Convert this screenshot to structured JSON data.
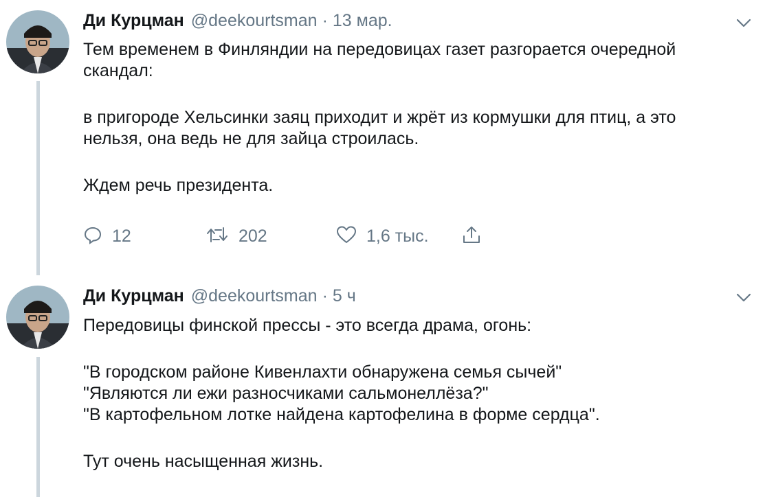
{
  "tweets": [
    {
      "author_name": "Ди Курцман",
      "handle": "@deekourtsman",
      "separator": "·",
      "time": "13 мар.",
      "lines": [
        "Тем временем в Финляндии на передовицах газет разгорается очередной",
        "скандал:",
        "в пригороде Хельсинки заяц приходит и жрёт из кормушки для птиц, а это",
        "нельзя, она ведь не для зайца строилась.",
        "Ждем речь президента."
      ],
      "replies": "12",
      "retweets": "202",
      "likes": "1,6 тыс."
    },
    {
      "author_name": "Ди Курцман",
      "handle": "@deekourtsman",
      "separator": "·",
      "time": "5 ч",
      "lines": [
        "Передовицы финской прессы - это всегда драма, огонь:",
        "\"В городском районе Кивенлахти обнаружена семья сычей\"",
        "\"Являются ли ежи разносчиками сальмонеллёза?\"",
        "\"В картофельном лотке найдена картофелина в форме сердца\".",
        "Тут очень насыщенная жизнь."
      ]
    }
  ],
  "icons": {
    "reply": "reply-icon",
    "retweet": "retweet-icon",
    "like": "heart-icon",
    "share": "share-icon",
    "more": "chevron-down-icon"
  },
  "colors": {
    "text": "#14171a",
    "secondary": "#657786",
    "thread_line": "#ccd6dd"
  }
}
